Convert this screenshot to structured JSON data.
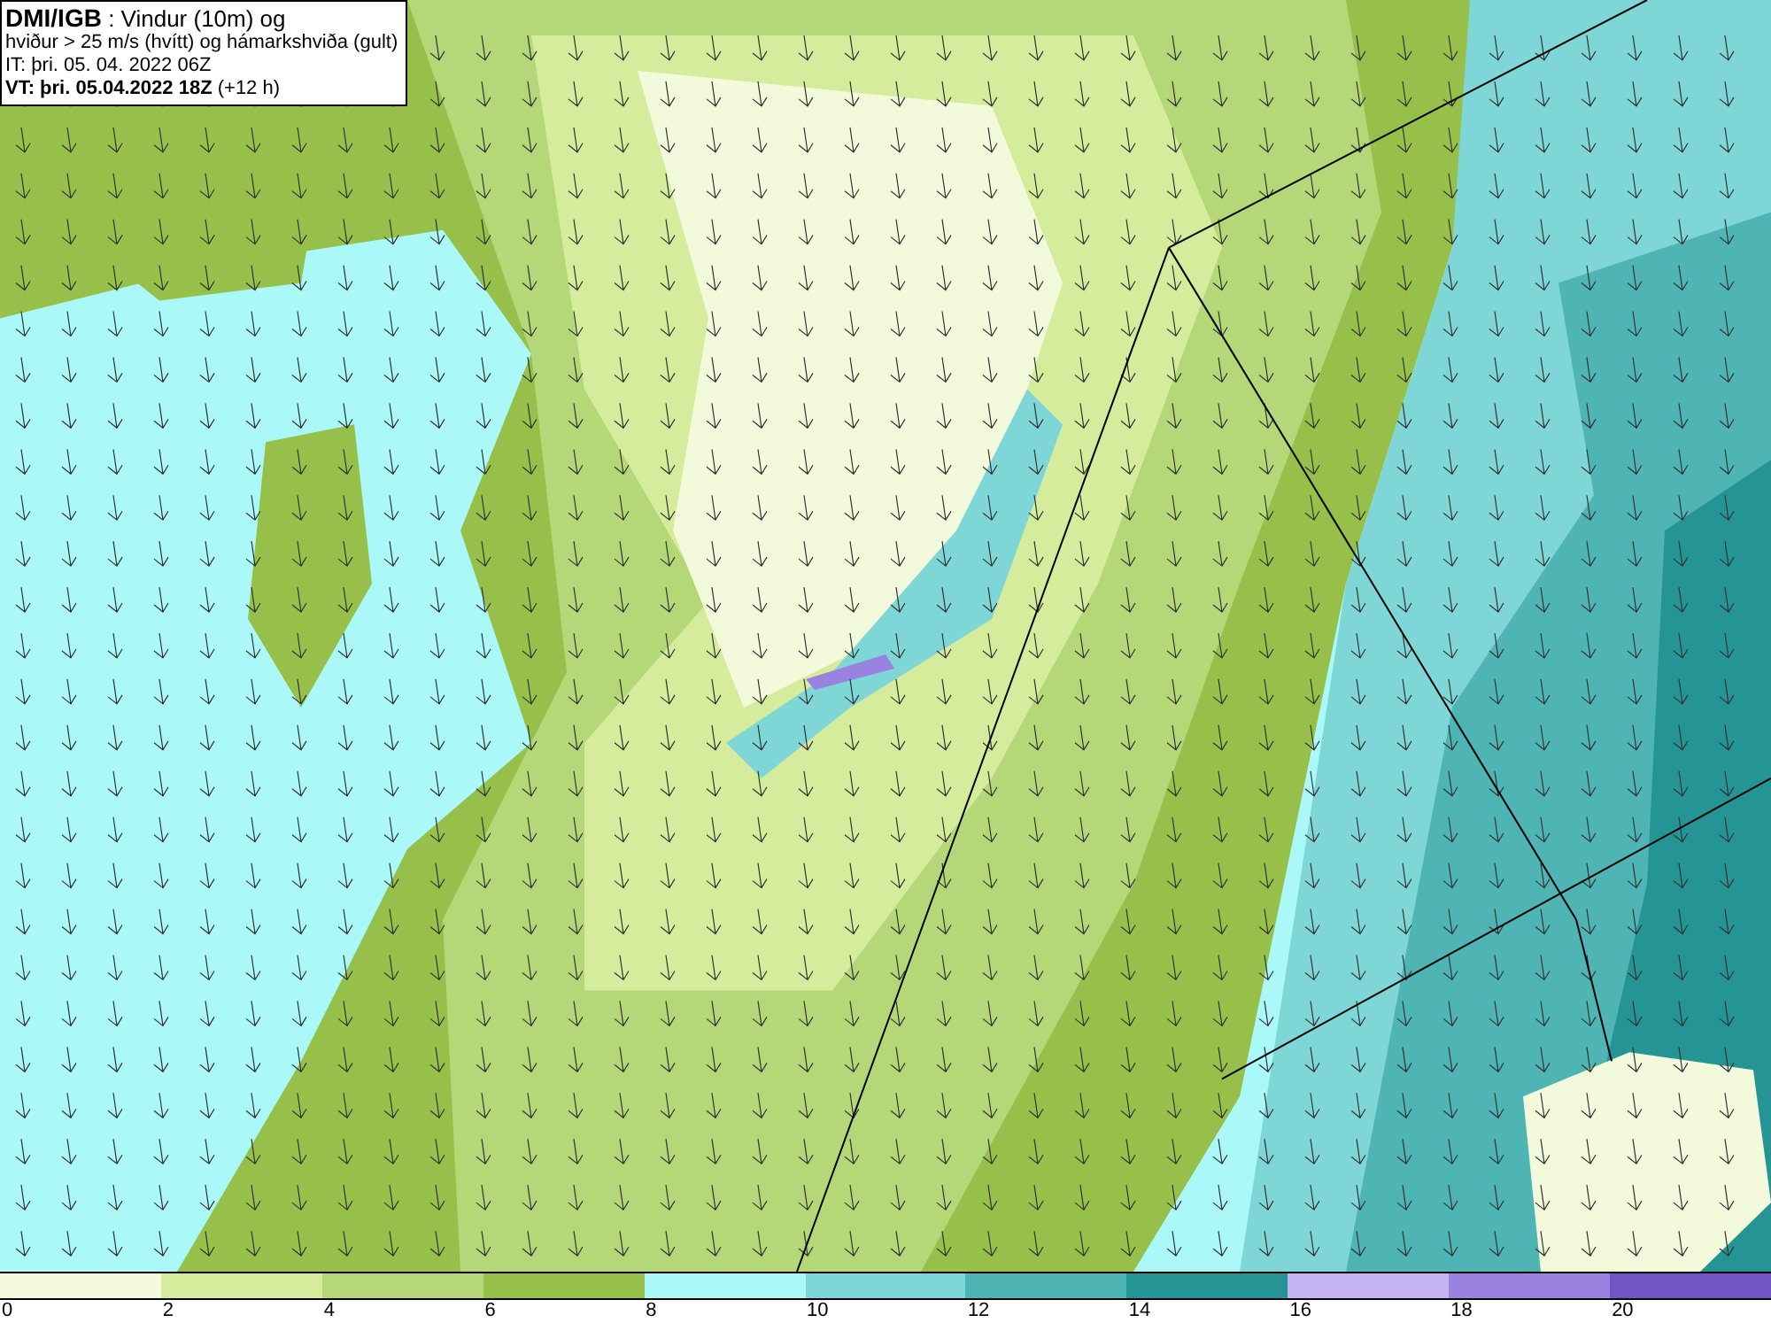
{
  "title_box": {
    "lines": [
      "**DMI/IGB** : Vindur (10m) og",
      "hviður > 25 m/s (hvítt) og hámarkshviða (gult)",
      "IT: þri. 05. 04. 2022 06Z",
      "**VT: þri. 05.04.2022 18Z** (+12 h)"
    ]
  },
  "legend": {
    "bins": [
      {
        "label": "0",
        "color": "#f3fadc"
      },
      {
        "label": "2",
        "color": "#d4ec9c"
      },
      {
        "label": "4",
        "color": "#b4d878"
      },
      {
        "label": "6",
        "color": "#96c04a"
      },
      {
        "label": "8",
        "color": "#aaf8f8"
      },
      {
        "label": "10",
        "color": "#7ed6d6"
      },
      {
        "label": "12",
        "color": "#4eb4b4"
      },
      {
        "label": "14",
        "color": "#259494"
      },
      {
        "label": "16",
        "color": "#c4b4f4"
      },
      {
        "label": "18",
        "color": "#9a82e0"
      },
      {
        "label": "20",
        "color": "#7056c4"
      }
    ]
  }
}
